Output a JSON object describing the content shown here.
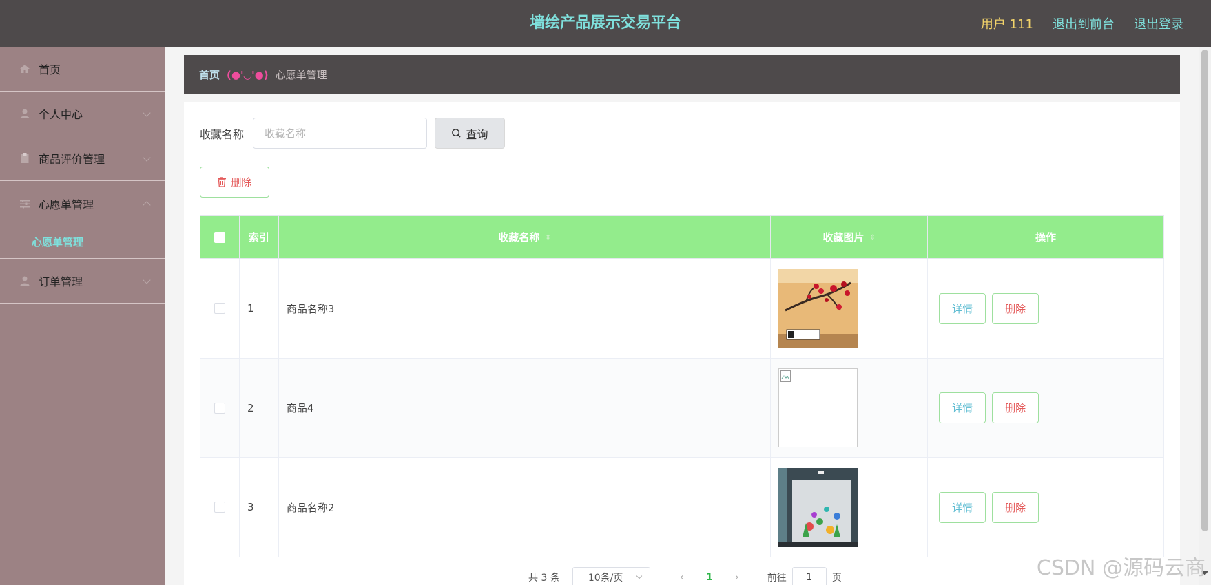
{
  "header": {
    "title": "墙绘产品展示交易平台",
    "user": "用户 111",
    "back_front": "退出到前台",
    "logout": "退出登录"
  },
  "sidebar": {
    "items": [
      {
        "label": "首页",
        "icon": "home-icon"
      },
      {
        "label": "个人中心",
        "icon": "user-icon"
      },
      {
        "label": "商品评价管理",
        "icon": "clipboard-icon"
      },
      {
        "label": "心愿单管理",
        "icon": "sliders-icon"
      },
      {
        "label": "订单管理",
        "icon": "user-icon"
      }
    ],
    "sub_item": "心愿单管理"
  },
  "breadcrumb": {
    "home": "首页",
    "separator": "(●'◡'●)",
    "current": "心愿单管理"
  },
  "search": {
    "label": "收藏名称",
    "placeholder": "收藏名称",
    "value": "",
    "button": "查询"
  },
  "toolbar": {
    "delete_label": "删除"
  },
  "table": {
    "headers": {
      "index": "索引",
      "name": "收藏名称",
      "image": "收藏图片",
      "ops": "操作"
    },
    "rows": [
      {
        "index": "1",
        "name": "商品名称3",
        "detail": "详情",
        "delete": "删除"
      },
      {
        "index": "2",
        "name": "商品4",
        "detail": "详情",
        "delete": "删除"
      },
      {
        "index": "3",
        "name": "商品名称2",
        "detail": "详情",
        "delete": "删除"
      }
    ]
  },
  "pagination": {
    "total": "共 3 条",
    "page_size": "10条/页",
    "current_page": "1",
    "goto": "前往",
    "jump_value": "1",
    "unit": "页"
  },
  "watermark": "CSDN @源码云商",
  "colors": {
    "header_bg": "#4e4a4b",
    "title": "#7fe0dc",
    "sidebar_bg": "#9c8284",
    "table_head": "#93ec8c",
    "delete": "#e45a5a"
  }
}
